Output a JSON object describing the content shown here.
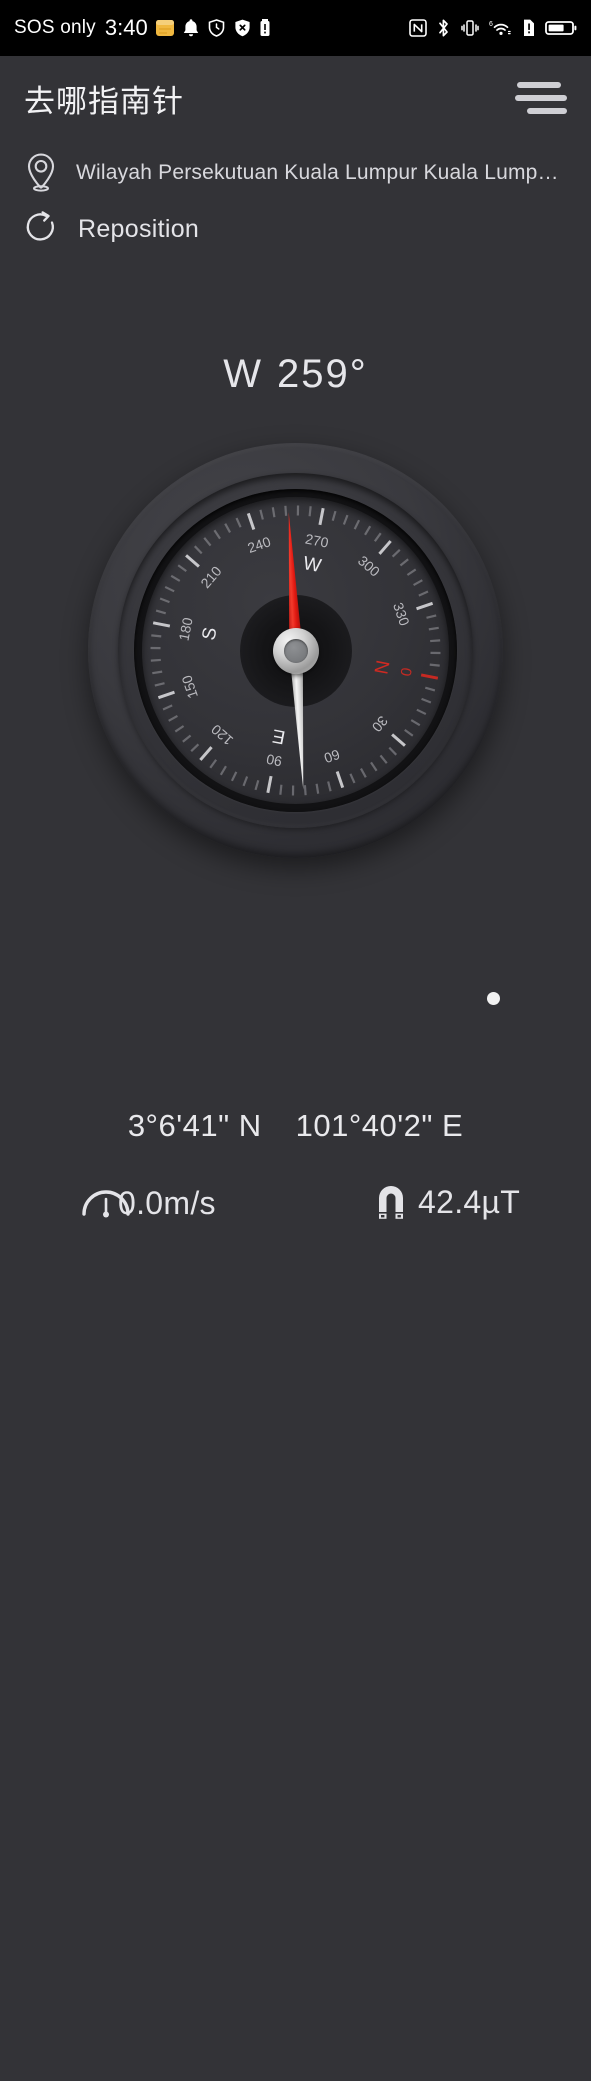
{
  "statusbar": {
    "carrier": "SOS only",
    "time": "3:40",
    "left_icons": [
      "calendar-icon",
      "bell-icon",
      "alarm-shield-icon",
      "shield-x-icon",
      "battery-alert-icon"
    ],
    "right_icons": [
      "nfc-icon",
      "bluetooth-icon",
      "vibrate-icon",
      "wifi-6-icon",
      "sim-alert-icon",
      "battery-icon"
    ]
  },
  "appbar": {
    "title": "去哪指南针",
    "menu_icon": "hamburger-menu-icon"
  },
  "location": {
    "pin_icon": "location-pin-icon",
    "address": "Wilayah Persekutuan Kuala Lumpur Kuala Lump…",
    "reposition_icon": "refresh-icon",
    "reposition_label": "Reposition"
  },
  "heading": {
    "direction": "W",
    "degrees": "259°"
  },
  "compass": {
    "needle_angle_deg": -3,
    "dial_rotation_deg": 101,
    "needle_red": "#e8241d",
    "needle_white": "#e2e2e2",
    "north_marker_color": "#cf2a22",
    "cardinals": [
      "N",
      "E",
      "S",
      "W"
    ],
    "degree_labels": [
      "0",
      "30",
      "60",
      "90",
      "120",
      "150",
      "180",
      "210",
      "240",
      "270",
      "300",
      "330"
    ]
  },
  "gallery": {
    "icon": "framed-picture-icon",
    "dot": "white-dot-indicator"
  },
  "coordinates": {
    "latitude": "3°6'41\" N",
    "longitude": "101°40'2\" E"
  },
  "sensors": {
    "speed_icon": "speedometer-icon",
    "speed_value": "0.0m/s",
    "magnet_icon": "magnet-icon",
    "magnetic_value": "42.4µT"
  },
  "colors": {
    "background": "#333337",
    "statusbar": "#000000",
    "text": "#e9e9ec",
    "accent_red": "#e8241d"
  }
}
